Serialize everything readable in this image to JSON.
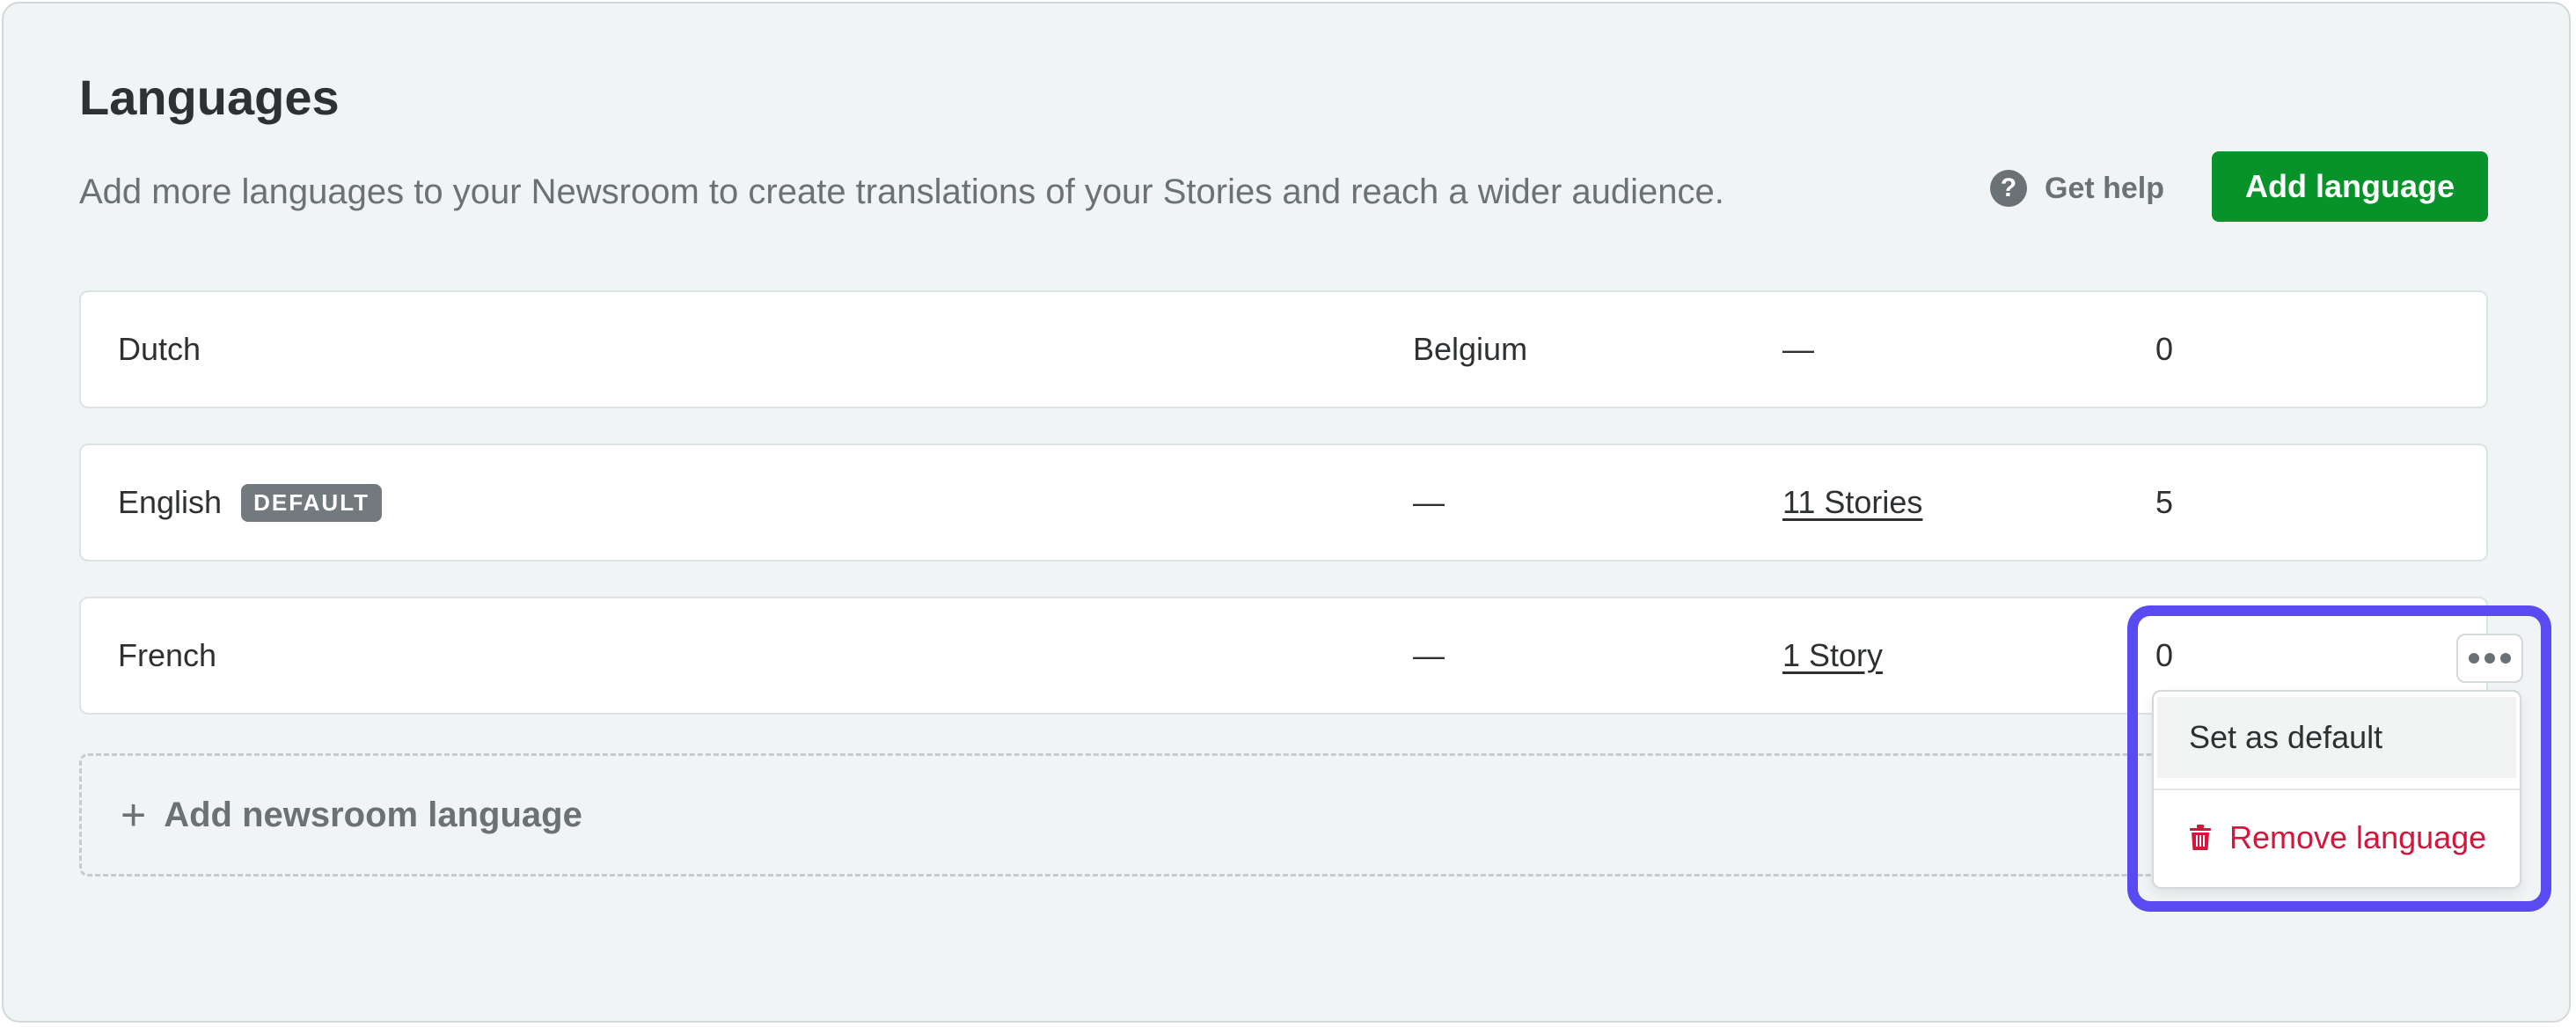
{
  "page": {
    "title": "Languages",
    "subtitle": "Add more languages to your Newsroom to create translations of your Stories and reach a wider audience."
  },
  "header_actions": {
    "help_label": "Get help",
    "help_icon": "question-circle-icon",
    "add_button_label": "Add language"
  },
  "languages": [
    {
      "name": "Dutch",
      "country": "Belgium",
      "stories": "—",
      "count": "0",
      "badge": ""
    },
    {
      "name": "English",
      "country": "—",
      "stories": "11 Stories",
      "count": "5",
      "badge": "DEFAULT"
    },
    {
      "name": "French",
      "country": "—",
      "stories": "1 Story",
      "count": "0",
      "badge": ""
    }
  ],
  "add_row": {
    "label": "Add newsroom language",
    "icon": "plus-icon"
  },
  "context_menu": {
    "trigger_icon": "more-horizontal-icon",
    "set_default_label": "Set as default",
    "remove_label": "Remove language",
    "remove_icon": "trash-icon"
  },
  "colors": {
    "accent_green": "#08932a",
    "danger_red": "#d4163c",
    "highlight": "#5a4af2",
    "badge_bg": "#737a7d"
  }
}
